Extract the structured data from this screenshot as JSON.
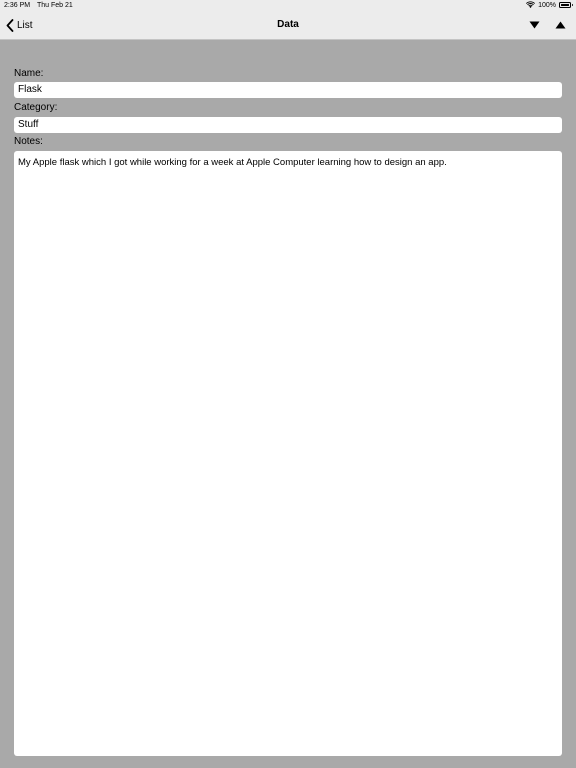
{
  "status_bar": {
    "time": "2:36 PM",
    "date": "Thu Feb 21",
    "battery": "100%"
  },
  "nav": {
    "back_label": "List",
    "title": "Data",
    "next_icon": "triangle-down-icon",
    "prev_icon": "triangle-up-icon"
  },
  "form": {
    "name_label": "Name:",
    "name_value": "Flask",
    "category_label": "Category:",
    "category_value": "Stuff",
    "notes_label": "Notes:",
    "notes_value": "My Apple flask which I got while working for a week at Apple Computer learning how to design an app."
  },
  "colors": {
    "background": "#a9a9a9",
    "bar": "#ececec",
    "field": "#ffffff"
  }
}
